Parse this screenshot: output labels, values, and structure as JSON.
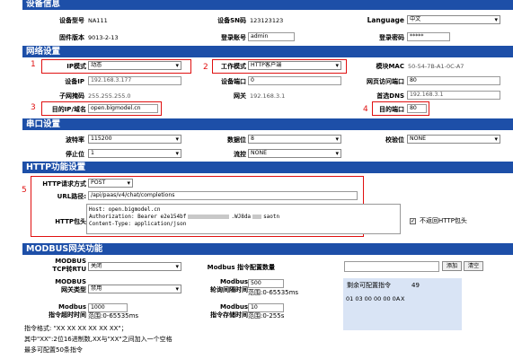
{
  "device_info": {
    "title": "设备信息",
    "model_label": "设备型号",
    "model_value": "NA111",
    "sn_label": "设备SN码",
    "sn_value": "123123123",
    "lang_label": "Language",
    "lang_value": "中文",
    "fw_label": "固件版本",
    "fw_value": "9013-2-13",
    "login_user_label": "登录账号",
    "login_user_value": "admin",
    "login_pass_label": "登录密码",
    "login_pass_value": "*****"
  },
  "network": {
    "title": "网络设置",
    "ip_mode_label": "IP模式",
    "ip_mode_value": "动态",
    "work_mode_label": "工作模式",
    "work_mode_value": "HTTP客户端",
    "mac_label": "模块MAC",
    "mac_value": "50-54-7B-A1-0C-A7",
    "dev_ip_label": "设备IP",
    "dev_ip_value": "192.168.3.177",
    "dev_port_label": "设备端口",
    "dev_port_value": "0",
    "web_port_label": "网页访问端口",
    "web_port_value": "80",
    "mask_label": "子网掩码",
    "mask_value": "255.255.255.0",
    "gw_label": "网关",
    "gw_value": "192.168.3.1",
    "dns_label": "首选DNS",
    "dns_value": "192.168.3.1",
    "target_ip_label": "目的IP/域名",
    "target_ip_value": "open.bigmodel.cn",
    "target_port_label": "目的端口",
    "target_port_value": "80"
  },
  "serial": {
    "title": "串口设置",
    "baud_label": "波特率",
    "baud_value": "115200",
    "data_bits_label": "数据位",
    "data_bits_value": "8",
    "parity_label": "校验位",
    "parity_value": "NONE",
    "stop_bits_label": "停止位",
    "stop_bits_value": "1",
    "flow_label": "流控",
    "flow_value": "NONE"
  },
  "http": {
    "title": "HTTP功能设置",
    "method_label": "HTTP请求方式",
    "method_value": "POST",
    "url_label": "URL路径:",
    "url_value": "/api/paas/v4/chat/completions",
    "header_label": "HTTP包头",
    "header_line1": "Host: open.bigmodel.cn",
    "header_line2a": "Authorization: Bearer e2e154bf",
    "header_line2b": ".WJ8da",
    "header_line2c": "saotn",
    "header_line3": "Content-Type: application/json",
    "no_return_header_label": "不返回HTTP包头"
  },
  "modbus": {
    "title": "MODBUS网关功能",
    "tcp_rtu_label_1": "MODBUS",
    "tcp_rtu_label_2": "TCP转RTU",
    "tcp_rtu_value": "关闭",
    "gateway_label_1": "MODBUS",
    "gateway_label_2": "网关类型",
    "gateway_value": "禁用",
    "timeout_label_1": "Modbus",
    "timeout_label_2": "指令超时时间",
    "timeout_value": "1000",
    "timeout_range": "范围:0-65535ms",
    "cmd_count_label": "Modbus 指令配置数量",
    "cmd_count_value": "500",
    "poll_label_1": "Modbus",
    "poll_label_2": "轮询间隔时间",
    "poll_range": "范围:0-65535ms",
    "store_label_1": "Modbus",
    "store_label_2": "指令存储时间",
    "store_value": "10",
    "store_range": "范围:0-255s",
    "add_button": "添加",
    "clear_button": "清空",
    "remaining_label": "剩余可配置指令",
    "remaining_value": "49",
    "cmd_item": "01 03 00 00 00 0A",
    "cmd_item_x": "X",
    "note1": "指令格式: \"XX XX XX XX XX XX\"；",
    "note2": "其中\"XX\":2位16进制数,XX与\"XX\"之间加入一个空格",
    "note3": "最多可配置50条指令"
  },
  "markers": {
    "m1": "1",
    "m2": "2",
    "m3": "3",
    "m4": "4",
    "m5": "5"
  },
  "colors": {
    "header_bg": "#1d4fa8",
    "highlight": "#e01010",
    "panel_bg": "#d9e4f5"
  }
}
